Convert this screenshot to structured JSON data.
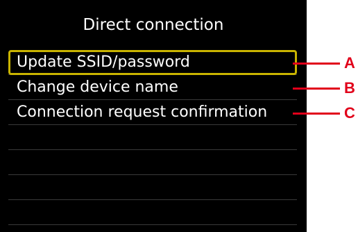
{
  "screen": {
    "title": "Direct connection",
    "menu_items": [
      {
        "label": "Update SSID/password",
        "callout": "A",
        "selected": true
      },
      {
        "label": "Change device name",
        "callout": "B",
        "selected": false
      },
      {
        "label": "Connection request confirmation",
        "callout": "C",
        "selected": false
      },
      {
        "label": "",
        "callout": "",
        "selected": false
      },
      {
        "label": "",
        "callout": "",
        "selected": false
      },
      {
        "label": "",
        "callout": "",
        "selected": false
      },
      {
        "label": "",
        "callout": "",
        "selected": false
      }
    ]
  },
  "colors": {
    "screen_background": "#000000",
    "text": "#ffffff",
    "selection_frame": "#c9b400",
    "callout": "#e1001a"
  }
}
